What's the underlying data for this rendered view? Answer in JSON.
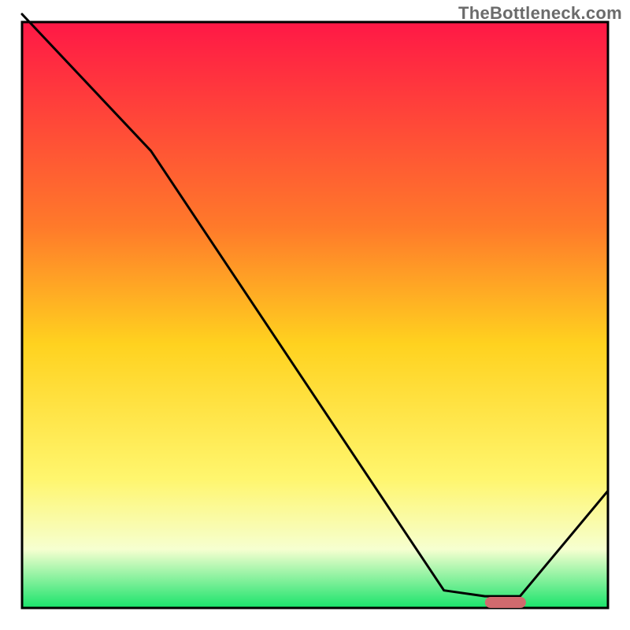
{
  "watermark": "TheBottleneck.com",
  "chart_data": {
    "type": "line",
    "title": "",
    "xlabel": "",
    "ylabel": "",
    "xlim": [
      0,
      100
    ],
    "ylim": [
      0,
      100
    ],
    "x": [
      0,
      22,
      72,
      79,
      85,
      100
    ],
    "values": [
      102,
      78,
      3,
      2,
      2,
      20
    ],
    "optimal_zone_x": [
      79,
      86
    ],
    "gradient_stops": [
      {
        "pct": 0,
        "color": "#ff1846"
      },
      {
        "pct": 35,
        "color": "#ff7a2a"
      },
      {
        "pct": 55,
        "color": "#ffd21f"
      },
      {
        "pct": 78,
        "color": "#fff66e"
      },
      {
        "pct": 90,
        "color": "#f6ffd0"
      },
      {
        "pct": 100,
        "color": "#19e36b"
      }
    ],
    "marker_color": "#d06a6e"
  }
}
